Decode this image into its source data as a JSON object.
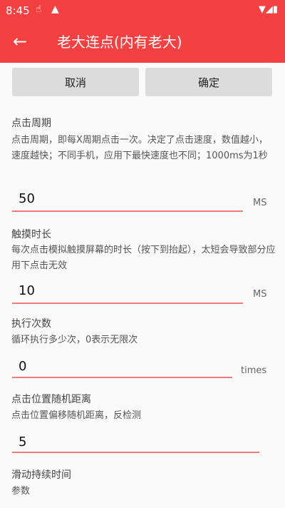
{
  "status": {
    "time": "8:45"
  },
  "appbar": {
    "title": "老大连点(内有老大)"
  },
  "actions": {
    "cancel": "取消",
    "confirm": "确定"
  },
  "settings": [
    {
      "label": "点击周期",
      "desc": "点击周期，即每X周期点击一次。决定了点击速度，数值越小，速度越快；不同手机，应用下最快速度也不同；1000ms为1秒",
      "value": "50",
      "unit": "MS"
    },
    {
      "label": "触摸时长",
      "desc": "每次点击模拟触摸屏幕的时长（按下到抬起），太短会导致部分应用下点击无效",
      "value": "10",
      "unit": "MS"
    },
    {
      "label": "执行次数",
      "desc": "循环执行多少次，0表示无限次",
      "value": "0",
      "unit": "times"
    },
    {
      "label": "点击位置随机距离",
      "desc": "点击位置偏移随机距离，反检测",
      "value": "5"
    },
    {
      "label": "滑动持续时间",
      "desc": "参数"
    }
  ]
}
